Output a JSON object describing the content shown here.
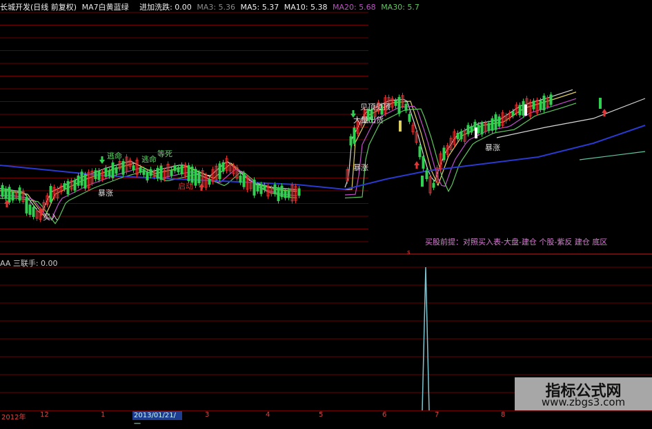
{
  "header": {
    "title": "长城开发(日线 前复权)",
    "items": [
      {
        "text": "MA7白黄蓝绿",
        "color": "#e6e6e6"
      },
      {
        "text": "进加洗跌: 0.00",
        "color": "#f0f0f0"
      },
      {
        "text": "MA3: 5.36",
        "color": "#8a8a8a"
      },
      {
        "text": "MA5: 5.37",
        "color": "#f0f0f0"
      },
      {
        "text": "MA10: 5.38",
        "color": "#f0f0f0"
      },
      {
        "text": "MA20: 5.68",
        "color": "#c04fc8"
      },
      {
        "text": "MA30: 5.7",
        "color": "#5fc85f"
      }
    ]
  },
  "annotations": [
    {
      "text": "逃命",
      "color": "#61d86b"
    },
    {
      "text": "逃命",
      "color": "#61d86b"
    },
    {
      "text": "等死",
      "color": "#61d86b"
    },
    {
      "text": "暴涨",
      "color": "#dddddd"
    },
    {
      "text": "暴涨",
      "color": "#dddddd"
    },
    {
      "text": "暴涨",
      "color": "#dddddd"
    },
    {
      "text": "见顶见顶",
      "color": "#dddddd"
    },
    {
      "text": "大量出货",
      "color": "#dddddd"
    },
    {
      "text": "启动",
      "color": "#e33333"
    },
    {
      "text": "买入",
      "color": "#dddddd"
    }
  ],
  "note": "买股前提：对照买入表-大盘-建仓  个股-紫反 建仓 底区",
  "indicator": {
    "label": "AA 三联手: 0.00",
    "signal_char": "s"
  },
  "xaxis": {
    "ticks": [
      "2012年",
      "12",
      "1",
      "3",
      "4",
      "5",
      "6",
      "7",
      "8"
    ],
    "selected_date": "2013/01/21/一"
  },
  "watermark": {
    "title": "指标公式网",
    "url": "www.zbgs3.com"
  },
  "colors": {
    "up": "#e03030",
    "down": "#30d050",
    "grid": "#6b0000"
  }
}
